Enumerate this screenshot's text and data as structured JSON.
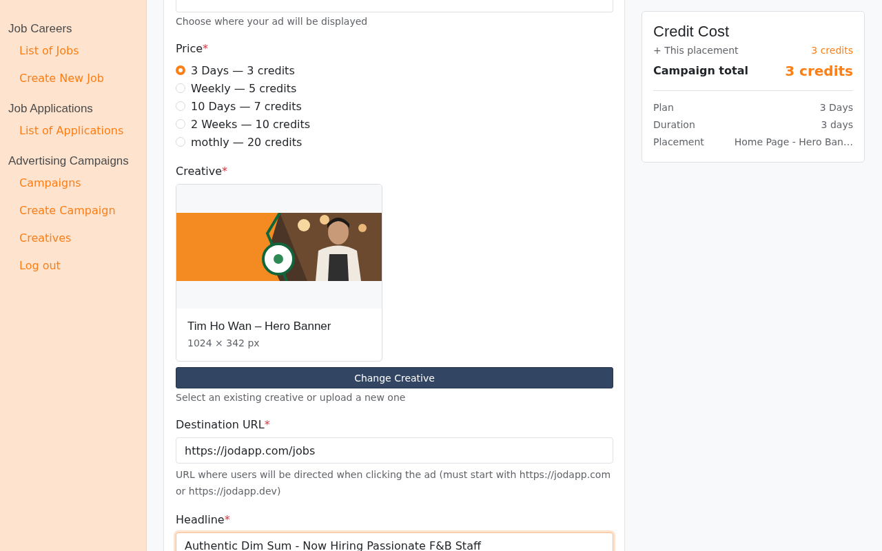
{
  "sidebar": {
    "sections": [
      {
        "heading": "Job Careers",
        "items": [
          {
            "label": "List of Jobs"
          },
          {
            "label": "Create New Job"
          }
        ]
      },
      {
        "heading": "Job Applications",
        "items": [
          {
            "label": "List of Applications"
          }
        ]
      },
      {
        "heading": "Advertising Campaigns",
        "items": [
          {
            "label": "Campaigns"
          },
          {
            "label": "Create Campaign"
          },
          {
            "label": "Creatives"
          },
          {
            "label": "Log out"
          }
        ]
      }
    ]
  },
  "form": {
    "placement_hint": "Choose where your ad will be displayed",
    "price": {
      "label": "Price",
      "required_mark": "*",
      "options": [
        {
          "label": "3 Days — 3 credits",
          "selected": true
        },
        {
          "label": "Weekly — 5 credits",
          "selected": false
        },
        {
          "label": "10 Days — 7 credits",
          "selected": false
        },
        {
          "label": "2 Weeks — 10 credits",
          "selected": false
        },
        {
          "label": "mothly — 20 credits",
          "selected": false
        }
      ]
    },
    "creative": {
      "label": "Creative",
      "required_mark": "*",
      "name": "Tim Ho Wan – Hero Banner",
      "size": "1024 × 342 px",
      "button": "Change Creative",
      "hint": "Select an existing creative or upload a new one"
    },
    "destination": {
      "label": "Destination URL",
      "required_mark": "*",
      "value": "https://jodapp.com/jobs",
      "hint": "URL where users will be directed when clicking the ad (must start with https://jodapp.com or https://jodapp.dev)"
    },
    "headline": {
      "label": "Headline",
      "required_mark": "*",
      "value": "Authentic Dim Sum - Now Hiring Passionate F&B Staff",
      "focused": true
    }
  },
  "credit_cost": {
    "title": "Credit Cost",
    "placement_label": "+ This placement",
    "placement_value": "3 credits",
    "total_label": "Campaign total",
    "total_value": "3 credits",
    "details": [
      {
        "label": "Plan",
        "value": "3 Days"
      },
      {
        "label": "Duration",
        "value": "3 days"
      },
      {
        "label": "Placement",
        "value": "Home Page - Hero Ban…"
      }
    ]
  }
}
